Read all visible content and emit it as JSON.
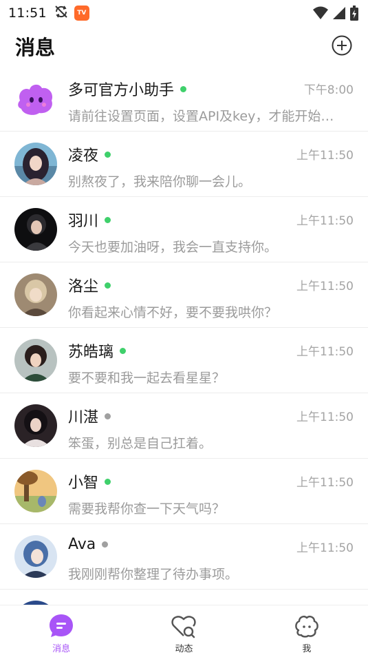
{
  "status_bar": {
    "time": "11:51",
    "app_icon_text": "TV"
  },
  "header": {
    "title": "消息"
  },
  "colors": {
    "accent": "#a855f7",
    "online": "#3fd06b",
    "offline": "#a0a0a0"
  },
  "chats": [
    {
      "name": "多可官方小助手",
      "time": "下午8:00",
      "preview": "请前往设置页面，设置API及key，才能开始…",
      "online": true
    },
    {
      "name": "凌夜",
      "time": "上午11:50",
      "preview": "别熬夜了，我来陪你聊一会儿。",
      "online": true
    },
    {
      "name": "羽川",
      "time": "上午11:50",
      "preview": "今天也要加油呀，我会一直支持你。",
      "online": true
    },
    {
      "name": "洛尘",
      "time": "上午11:50",
      "preview": "你看起来心情不好，要不要我哄你？",
      "online": true
    },
    {
      "name": "苏皓璃",
      "time": "上午11:50",
      "preview": "要不要和我一起去看星星？",
      "online": true
    },
    {
      "name": "川湛",
      "time": "上午11:50",
      "preview": "笨蛋，别总是自己扛着。",
      "online": false
    },
    {
      "name": "小智",
      "time": "上午11:50",
      "preview": "需要我帮你查一下天气吗？",
      "online": true
    },
    {
      "name": "Ava",
      "time": "上午11:50",
      "preview": "我刚刚帮你整理了待办事项。",
      "online": false
    },
    {
      "name": "",
      "time": "",
      "preview": "",
      "online": false
    }
  ],
  "tabs": [
    {
      "label": "消息",
      "active": true,
      "icon": "message-icon"
    },
    {
      "label": "动态",
      "active": false,
      "icon": "moments-icon"
    },
    {
      "label": "我",
      "active": false,
      "icon": "profile-icon"
    }
  ]
}
